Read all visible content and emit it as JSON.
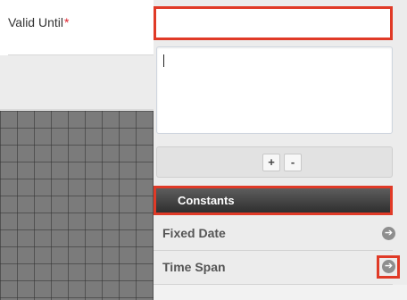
{
  "field": {
    "label": "Valid Until",
    "required_mark": "*",
    "value": ""
  },
  "controls": {
    "plus": "+",
    "minus": "-"
  },
  "constants": {
    "header": "Constants",
    "items": [
      {
        "label": "Fixed Date",
        "icon": "arrow-right-circle-icon"
      },
      {
        "label": "Time Span",
        "icon": "arrow-right-circle-icon"
      }
    ]
  },
  "colors": {
    "highlight": "#e03a27",
    "required": "#e0242f"
  }
}
